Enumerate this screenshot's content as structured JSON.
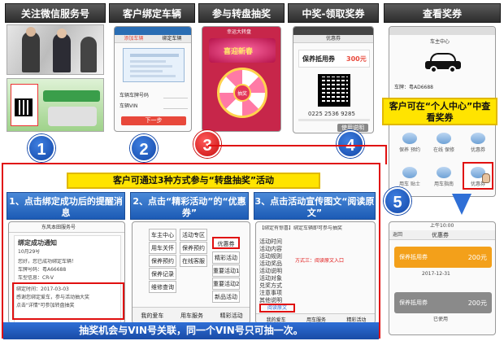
{
  "headers": {
    "col1": "关注微信服务号",
    "col2": "客户绑定车辆",
    "col3": "参与转盘抽奖",
    "col4": "中奖-领取奖券",
    "col5": "查看奖券"
  },
  "steps": {
    "s1": "1",
    "s2": "2",
    "s3": "3",
    "s4": "4",
    "s5": "5"
  },
  "p2": {
    "tab_left": "添加车辆",
    "tab_right": "绑定车辆",
    "plate_label": "车辆车牌号码",
    "vin_label": "车辆VIN",
    "next_btn": "下一步"
  },
  "p3": {
    "top_text": "幸运大转盘",
    "banner": "喜迎新春",
    "center": "抽奖"
  },
  "p4": {
    "title": "优惠券",
    "coupon_name": "保养抵用券",
    "coupon_value": "300元",
    "code": "0225 2536 9285",
    "btn": "使用说明"
  },
  "p5": {
    "title": "车主中心",
    "plate_prefix": "车牌：粤A",
    "plate_value": "D6688",
    "cells": [
      "保养 预约",
      "在线 保修",
      "优惠券",
      "用车 贴士",
      "用车指南",
      "优惠券"
    ],
    "callout": "客户可在“个人中心”中查看奖券"
  },
  "p6": {
    "status": "上午10:00",
    "title": "优惠券",
    "back": "返回",
    "coupon1_name": "保养抵用券",
    "coupon1_value": "200元",
    "coupon1_date": "2017-12-31",
    "coupon2_name": "保养抵用券",
    "coupon2_value": "200元",
    "coupon2_status": "已使用"
  },
  "bottom": {
    "banner": "客户可通过3种方式参与“转盘抽奖”活动",
    "method1": "1、点击绑定成功后的提醒消息",
    "method2": "2、点击“精彩活动”的“优惠券”",
    "method3": "3、点击活动宣传图文“阅读原文”",
    "footer": "抽奖机会与VIN号关联，同一个VIN号只可抽一次。"
  },
  "m1": {
    "account": "东风本田服务号",
    "msg_title": "绑定成功通知",
    "msg_date": "10月29号",
    "msg_greet": "您好，您已成功绑定车辆！",
    "msg_plate": "车牌号码：粤A66688",
    "msg_model": "车型信息：CR-V",
    "msg_time": "绑定时间：2017-03-03",
    "msg_desc": "感谢您绑定爱车，参与活动抽大奖",
    "msg_link": "点击\"详情\"可参加转盘抽奖"
  },
  "m2": {
    "menu": [
      "车主中心",
      "用车关怀",
      "保养预约",
      "保养记录",
      "维修查询",
      "活动专区",
      "保养预约",
      "在线客服",
      "优惠券",
      "精彩活动",
      "重要活动1",
      "重要活动2",
      "新品活动"
    ],
    "bottom_left": "我的爱车",
    "bottom_mid": "用车服务",
    "bottom_right": "精彩活动"
  },
  "m3": {
    "heading": "【绑定有惊喜】",
    "heading2": "绑定车辆即可参与抽奖",
    "lines": [
      "活动时间",
      "活动内容",
      "活动规则",
      "活动奖品",
      "活动说明",
      "活动对象",
      "兑奖方式",
      "注意事项",
      "其他说明"
    ],
    "annotation": "方式三：阅读原文入口",
    "read_more": "阅读原文",
    "bottom_left": "我的爱车",
    "bottom_mid": "用车服务",
    "bottom_right": "精彩活动"
  },
  "colors": {
    "red": "#e01010",
    "yellow": "#ffe400",
    "blue": "#1c5bb5",
    "orange": "#f3a01a",
    "grey_coupon": "#8a8a8a"
  }
}
